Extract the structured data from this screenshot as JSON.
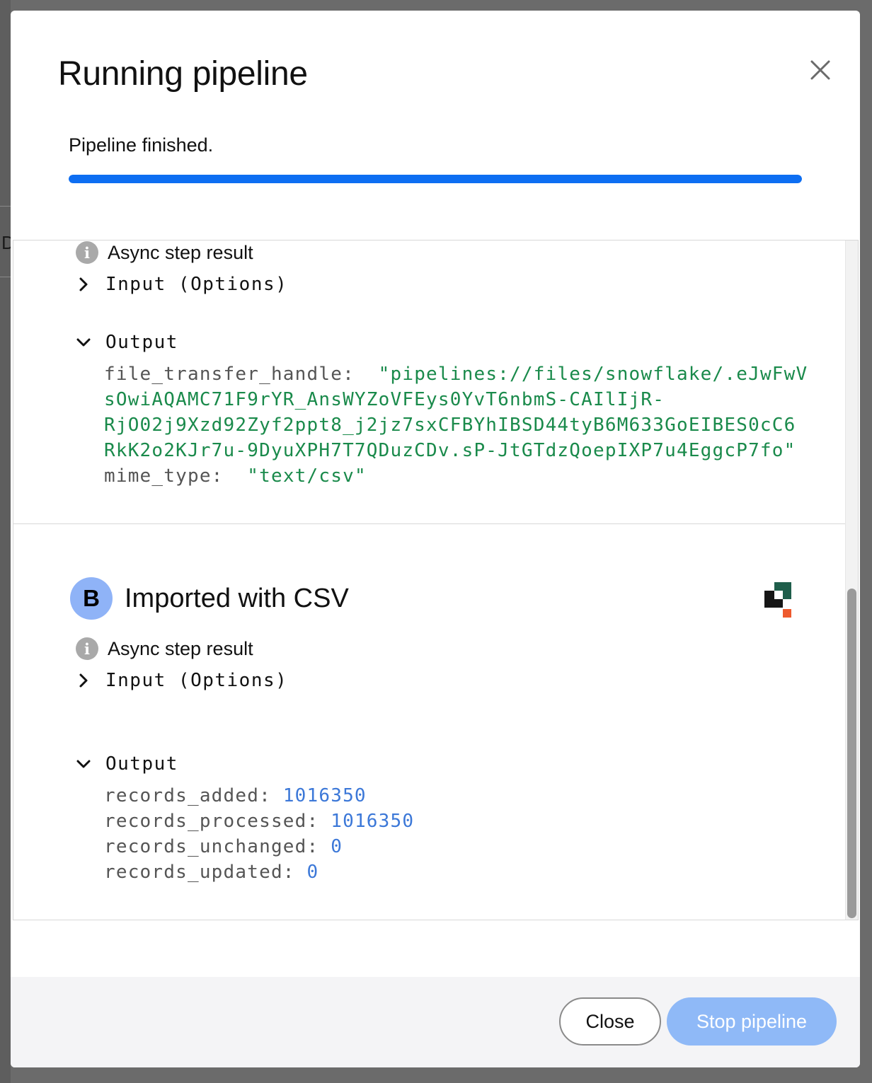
{
  "backdrop": {
    "partial_letter": "D"
  },
  "modal": {
    "title": "Running pipeline",
    "status": "Pipeline finished.",
    "progress_fraction": 1.0,
    "colors": {
      "progress": "#0d6ef2",
      "string_value": "#1a8a4b",
      "number_value": "#3c78d8",
      "step_badge": "#8fb3f7",
      "primary_button": "#8fb9f7"
    }
  },
  "step_a": {
    "result_label": "Async step result",
    "input_label": "Input (Options)",
    "output_label": "Output",
    "output": {
      "file_transfer_handle_key": "file_transfer_handle:",
      "file_transfer_handle_lines": [
        "\"pipelines://files/snowflake/.eJwFwV",
        "sOwiAQAMC71F9rYR_AnsWYZoVFEys0YvT6nbmS-CAIlIjR-",
        "RjO02j9Xzd92Zyf2ppt8_j2jz7sxCFBYhIBSD44tyB6M633GoEIBES0cC6",
        "RkK2o2KJr7u-9DyuXPH7T7QDuzCDv.sP-JtGTdzQoepIXP7u4EggcP7fo\""
      ],
      "mime_type_key": "mime_type:",
      "mime_type_value": "\"text/csv\""
    }
  },
  "step_b": {
    "badge": "B",
    "title": "Imported with CSV",
    "result_label": "Async step result",
    "input_label": "Input (Options)",
    "output_label": "Output",
    "output": [
      {
        "key": "records_added:",
        "value": "1016350"
      },
      {
        "key": "records_processed:",
        "value": "1016350"
      },
      {
        "key": "records_unchanged:",
        "value": "0"
      },
      {
        "key": "records_updated:",
        "value": "0"
      }
    ]
  },
  "footer": {
    "close_label": "Close",
    "stop_label": "Stop pipeline"
  }
}
